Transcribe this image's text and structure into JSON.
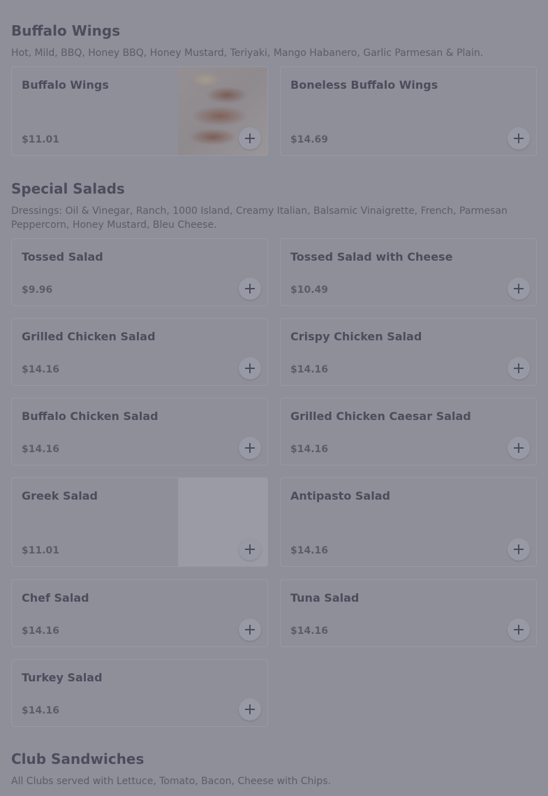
{
  "sections": [
    {
      "title": "Buffalo Wings",
      "description": "Hot, Mild, BBQ, Honey BBQ, Honey Mustard, Teriyaki, Mango Habanero, Garlic Parmesan & Plain.",
      "items": [
        {
          "name": "Buffalo Wings",
          "price": "$11.01"
        },
        {
          "name": "Boneless Buffalo Wings",
          "price": "$14.69"
        }
      ]
    },
    {
      "title": "Special Salads",
      "description": "Dressings: Oil & Vinegar, Ranch, 1000 Island, Creamy Italian, Balsamic Vinaigrette, French, Parmesan Peppercorn, Honey Mustard, Bleu Cheese.",
      "items": [
        {
          "name": "Tossed Salad",
          "price": "$9.96"
        },
        {
          "name": "Tossed Salad with Cheese",
          "price": "$10.49"
        },
        {
          "name": "Grilled Chicken Salad",
          "price": "$14.16"
        },
        {
          "name": "Crispy Chicken Salad",
          "price": "$14.16"
        },
        {
          "name": "Buffalo Chicken Salad",
          "price": "$14.16"
        },
        {
          "name": "Grilled Chicken Caesar Salad",
          "price": "$14.16"
        },
        {
          "name": "Greek Salad",
          "price": "$11.01"
        },
        {
          "name": "Antipasto Salad",
          "price": "$14.16"
        },
        {
          "name": "Chef Salad",
          "price": "$14.16"
        },
        {
          "name": "Tuna Salad",
          "price": "$14.16"
        },
        {
          "name": "Turkey Salad",
          "price": "$14.16"
        }
      ]
    },
    {
      "title": "Club Sandwiches",
      "description": "All Clubs served with Lettuce, Tomato, Bacon, Cheese with Chips.",
      "items": []
    }
  ],
  "icons": {
    "add": "plus-icon"
  },
  "colors": {
    "overlay": "#8e8f99",
    "text": "#4b4d5c"
  }
}
